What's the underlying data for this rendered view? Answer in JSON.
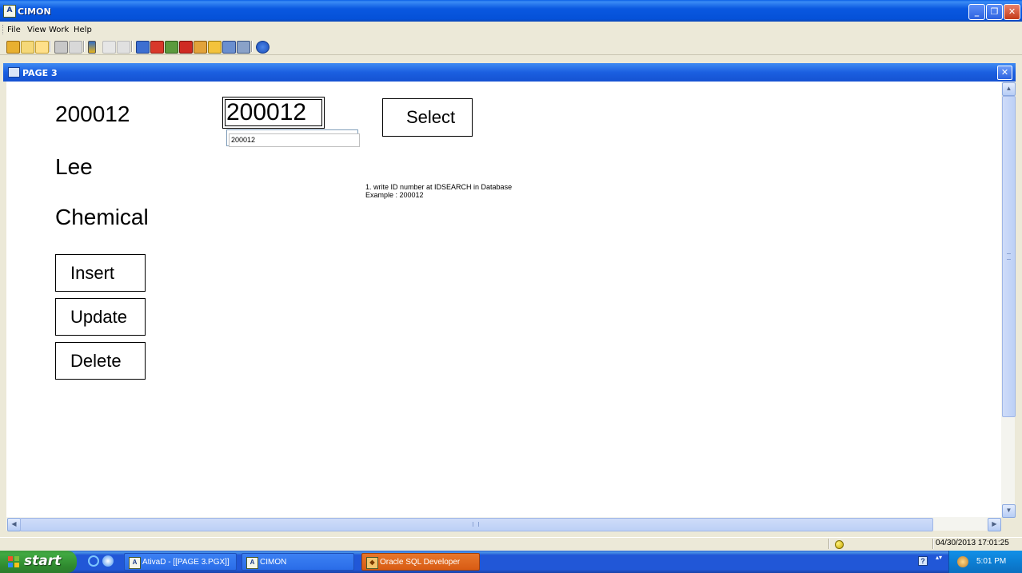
{
  "window": {
    "title": "CIMON"
  },
  "menu": {
    "file": "File",
    "view": "View",
    "work": "Work",
    "help": "Help"
  },
  "toolbar": {
    "icons": [
      "open-folder-icon",
      "email-icon",
      "window-icon",
      "print-icon",
      "brush-icon",
      "tag-icon",
      "shield-icon",
      "key-icon",
      "display-icon",
      "pencil-icon",
      "network-icon",
      "alarm-icon",
      "tools-icon",
      "star-icon",
      "database-icon",
      "report-icon",
      "help-icon"
    ]
  },
  "child_window": {
    "title": "PAGE 3"
  },
  "page": {
    "id_label": "200012",
    "id_value_box": "200012",
    "id_input": "200012",
    "name": "Lee",
    "department": "Chemical",
    "buttons": {
      "select": "Select",
      "insert": "Insert",
      "update": "Update",
      "delete": "Delete"
    },
    "note_line1": "1. write ID number at IDSEARCH in Database",
    "note_line2": "Example : 200012"
  },
  "status": {
    "datetime": "04/30/2013 17:01:25"
  },
  "taskbar": {
    "start": "start",
    "tasks": [
      {
        "label": "AtivaD - [[PAGE 3.PGX]]",
        "active": false
      },
      {
        "label": "CIMON",
        "active": false
      },
      {
        "label": "Oracle SQL Developer",
        "active": true
      }
    ],
    "clock": "5:01 PM"
  }
}
